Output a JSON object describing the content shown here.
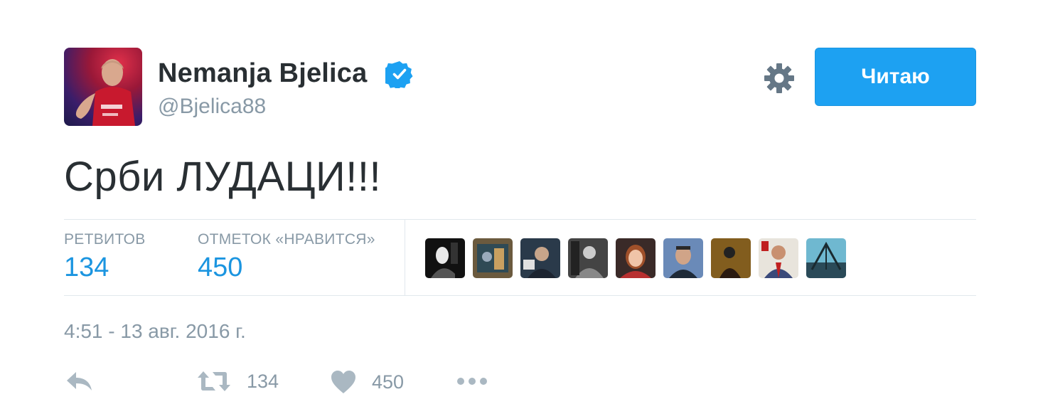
{
  "author": {
    "display_name": "Nemanja Bjelica",
    "handle": "@Bjelica88",
    "verified": true
  },
  "header": {
    "follow_label": "Читаю",
    "settings_icon": "gear-icon"
  },
  "tweet": {
    "text": "Срби ЛУДАЦИ!!!",
    "timestamp": "4:51 - 13 авг. 2016 г."
  },
  "stats": {
    "retweets_label": "РЕТВИТОВ",
    "retweets_count": "134",
    "likes_label": "ОТМЕТОК «НРАВИТСЯ»",
    "likes_count": "450"
  },
  "likers_count_shown": 9,
  "actions": {
    "reply_icon": "reply-icon",
    "retweet_icon": "retweet-icon",
    "retweet_count": "134",
    "like_icon": "heart-icon",
    "like_count": "450",
    "more_icon": "more-icon"
  },
  "colors": {
    "accent": "#1da1f2",
    "link": "#1b95e0",
    "muted": "#8899a6",
    "verified": "#1da1f2"
  }
}
